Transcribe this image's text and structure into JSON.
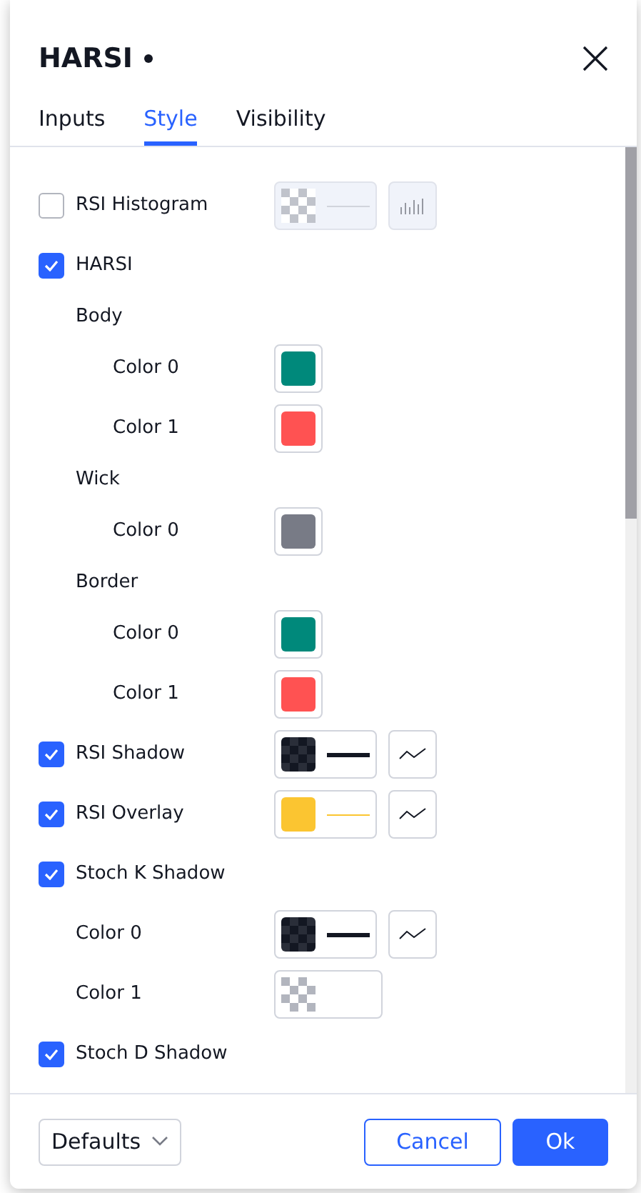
{
  "dialog": {
    "title": "HARSI",
    "modified": true
  },
  "tabs": [
    {
      "label": "Inputs",
      "selected": false
    },
    {
      "label": "Style",
      "selected": true
    },
    {
      "label": "Visibility",
      "selected": false
    }
  ],
  "rows": [
    {
      "kind": "checkbox",
      "label": "RSI Histogram",
      "checked": false,
      "disabled": true,
      "swatch": {
        "kind": "transparent",
        "color": "#c0c3cb"
      },
      "line": {
        "color": "#d1d4dc",
        "kind": "thin"
      },
      "plot_style": {
        "kind": "histogram"
      }
    },
    {
      "kind": "checkbox",
      "label": "HARSI",
      "checked": true,
      "children": [
        {
          "kind": "heading",
          "label": "Body",
          "children": [
            {
              "kind": "color",
              "label": "Color 0",
              "swatch": {
                "kind": "solid",
                "color": "#00897b"
              }
            },
            {
              "kind": "color",
              "label": "Color 1",
              "swatch": {
                "kind": "solid",
                "color": "#ff5252"
              }
            }
          ]
        },
        {
          "kind": "heading",
          "label": "Wick",
          "children": [
            {
              "kind": "color",
              "label": "Color 0",
              "swatch": {
                "kind": "solid",
                "color": "#787b86"
              }
            }
          ]
        },
        {
          "kind": "heading",
          "label": "Border",
          "children": [
            {
              "kind": "color",
              "label": "Color 0",
              "swatch": {
                "kind": "solid",
                "color": "#00897b"
              }
            },
            {
              "kind": "color",
              "label": "Color 1",
              "swatch": {
                "kind": "solid",
                "color": "#ff5252"
              }
            }
          ]
        }
      ]
    },
    {
      "kind": "checkbox",
      "label": "RSI Shadow",
      "checked": true,
      "swatch": {
        "kind": "semi-transparent",
        "color": "#131722"
      },
      "line": {
        "color": "#131722",
        "kind": "thick"
      },
      "plot_style": {
        "kind": "line"
      }
    },
    {
      "kind": "checkbox",
      "label": "RSI Overlay",
      "checked": true,
      "swatch": {
        "kind": "solid",
        "color": "#fbc531"
      },
      "line": {
        "color": "#fbc531",
        "kind": "thin"
      },
      "plot_style": {
        "kind": "line"
      }
    },
    {
      "kind": "checkbox",
      "label": "Stoch K Shadow",
      "checked": true,
      "children": [
        {
          "kind": "color",
          "label": "Color 0",
          "swatch": {
            "kind": "semi-transparent",
            "color": "#131722"
          },
          "line": {
            "color": "#131722",
            "kind": "thick"
          },
          "plot_style": {
            "kind": "line"
          }
        },
        {
          "kind": "color",
          "label": "Color 1",
          "swatch": {
            "kind": "transparent",
            "color": "#b2b5be"
          }
        }
      ]
    },
    {
      "kind": "checkbox",
      "label": "Stoch D Shadow",
      "checked": true
    }
  ],
  "footer": {
    "defaults": "Defaults",
    "cancel": "Cancel",
    "ok": "Ok"
  }
}
